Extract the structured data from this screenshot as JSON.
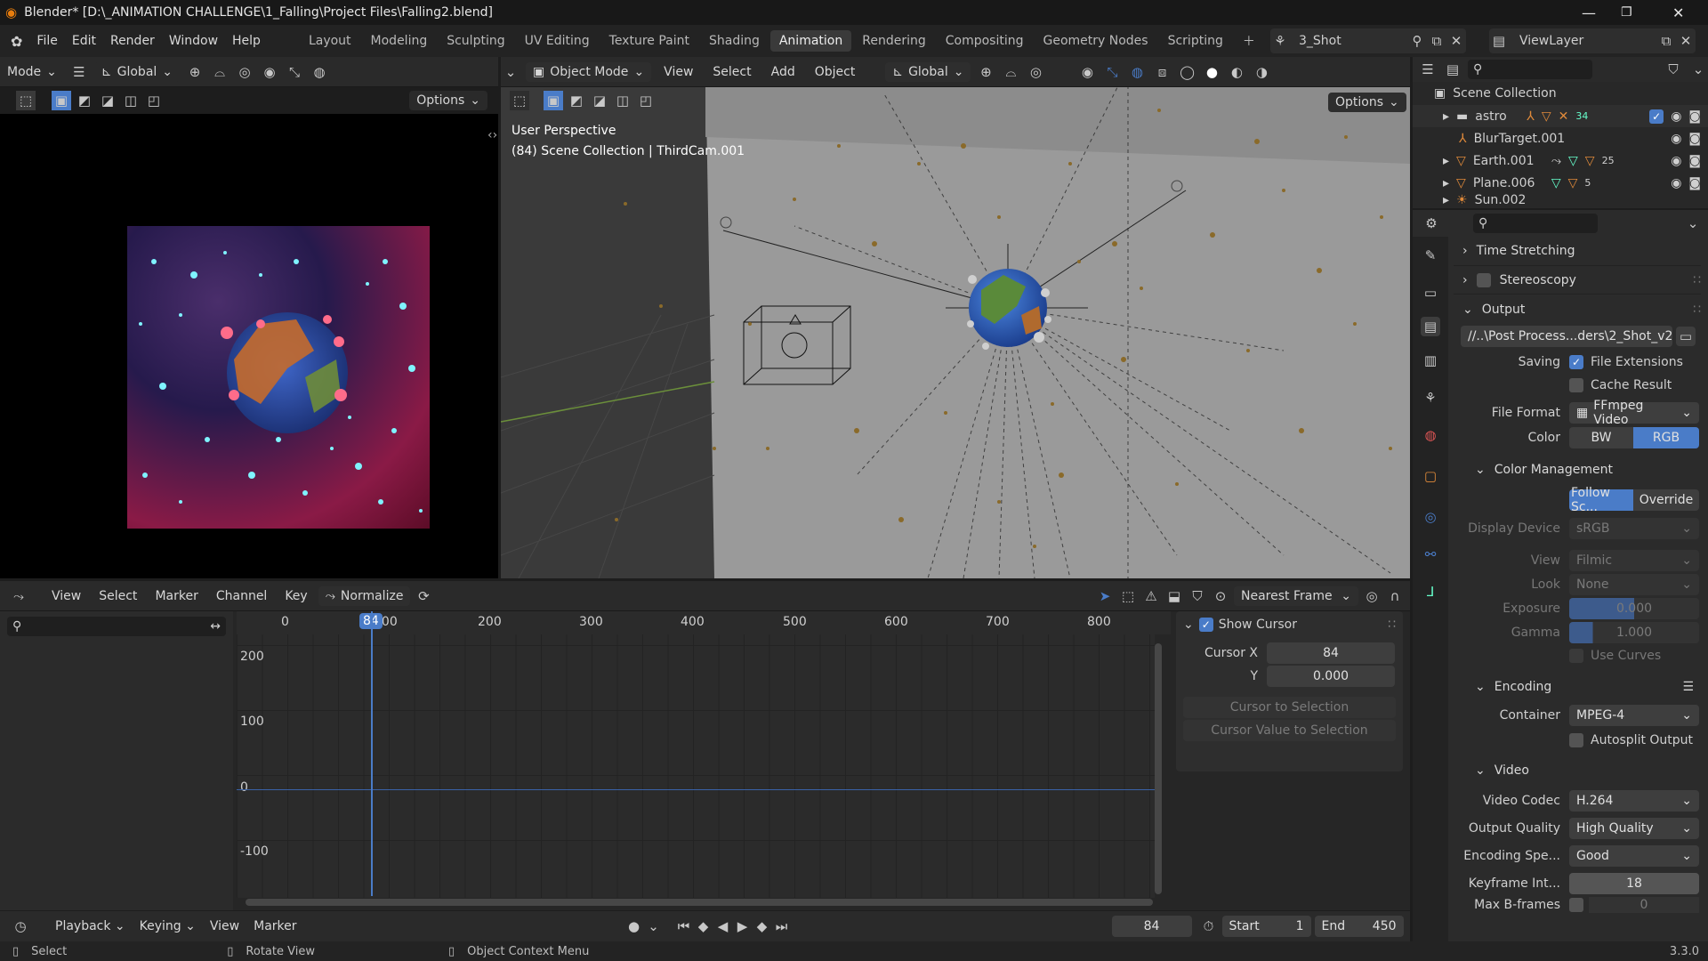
{
  "window": {
    "title": "Blender* [D:\\_ANIMATION CHALLENGE\\1_Falling\\Project Files\\Falling2.blend]"
  },
  "menu": {
    "items": [
      "File",
      "Edit",
      "Render",
      "Window",
      "Help"
    ]
  },
  "workspaces": [
    "Layout",
    "Modeling",
    "Sculpting",
    "UV Editing",
    "Texture Paint",
    "Shading",
    "Animation",
    "Rendering",
    "Compositing",
    "Geometry Nodes",
    "Scripting"
  ],
  "active_workspace": "Animation",
  "scene": {
    "name": "3_Shot"
  },
  "view_layer": {
    "name": "ViewLayer"
  },
  "left_editor": {
    "mode_label": "Mode",
    "transform": "Global",
    "options": "Options"
  },
  "viewport": {
    "mode": "Object Mode",
    "menus": [
      "View",
      "Select",
      "Add",
      "Object"
    ],
    "transform": "Global",
    "options": "Options",
    "overlay_title": "User Perspective",
    "overlay_sub": "(84) Scene Collection | ThirdCam.001"
  },
  "graph_editor": {
    "menus": [
      "View",
      "Select",
      "Marker",
      "Channel",
      "Key"
    ],
    "normalize": "Normalize",
    "snap": "Nearest Frame",
    "frame_ticks": [
      "0",
      "100",
      "200",
      "300",
      "400",
      "500",
      "600",
      "700",
      "800"
    ],
    "current_frame": "84",
    "value_ticks": [
      "200",
      "100",
      "0",
      "-100"
    ],
    "sidebar": {
      "show_cursor": "Show Cursor",
      "cursor_x_label": "Cursor X",
      "cursor_x": "84",
      "y_label": "Y",
      "y": "0.000",
      "btn1": "Cursor to Selection",
      "btn2": "Cursor Value to Selection"
    }
  },
  "timeline": {
    "menus": [
      "Playback",
      "Keying",
      "View",
      "Marker"
    ],
    "frame": "84",
    "start_label": "Start",
    "start": "1",
    "end_label": "End",
    "end": "450"
  },
  "outliner": {
    "root": "Scene Collection",
    "items": [
      "astro",
      "BlurTarget.001",
      "Earth.001",
      "Plane.006",
      "Sun.002"
    ],
    "badge_astro": "34",
    "badge_earth": "25",
    "badge_plane": "5"
  },
  "properties": {
    "sections": {
      "time_stretching": "Time Stretching",
      "stereoscopy": "Stereoscopy",
      "output": "Output",
      "color_management": "Color Management",
      "encoding": "Encoding",
      "video": "Video"
    },
    "output_path": "//..\\Post Process...ders\\2_Shot_v2_",
    "saving_label": "Saving",
    "file_extensions": "File Extensions",
    "cache_result": "Cache Result",
    "file_format_label": "File Format",
    "file_format": "FFmpeg Video",
    "color_label": "Color",
    "color_bw": "BW",
    "color_rgb": "RGB",
    "follow_scene": "Follow Sc...",
    "override": "Override",
    "display_device_label": "Display Device",
    "display_device": "sRGB",
    "view_label": "View",
    "view": "Filmic",
    "look_label": "Look",
    "look": "None",
    "exposure_label": "Exposure",
    "exposure": "0.000",
    "gamma_label": "Gamma",
    "gamma": "1.000",
    "use_curves": "Use Curves",
    "container_label": "Container",
    "container": "MPEG-4",
    "autosplit": "Autosplit Output",
    "video_codec_label": "Video Codec",
    "video_codec": "H.264",
    "output_quality_label": "Output Quality",
    "output_quality": "High Quality",
    "encoding_speed_label": "Encoding Spe...",
    "encoding_speed": "Good",
    "keyframe_label": "Keyframe Int...",
    "keyframe": "18",
    "max_bframes_label": "Max B-frames",
    "max_bframes": "0"
  },
  "status": {
    "select": "Select",
    "rotate": "Rotate View",
    "context": "Object Context Menu",
    "version": "3.3.0"
  },
  "colors": {
    "accent": "#4a7cc8",
    "frame_indicator": "#4a7cc8",
    "header": "#2a2a2a"
  }
}
